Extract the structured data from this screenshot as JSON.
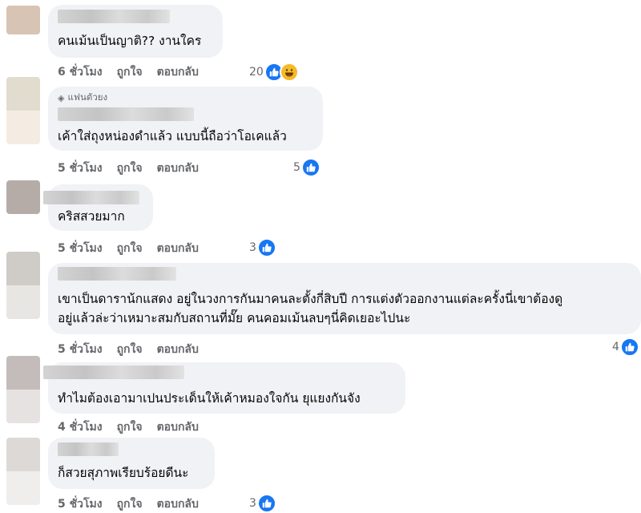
{
  "comments": [
    {
      "text": "คนเม้นเป็นญาติ?? งานใคร",
      "actions": {
        "time": "6 ชั่วโมง",
        "like": "ถูกใจ",
        "reply": "ตอบกลับ"
      },
      "reaction_count": "20",
      "reactions": [
        "like-icon",
        "haha-icon"
      ]
    },
    {
      "badge": "แฟนตัวยง",
      "text": "เค้าใส่ถุงหน่องดำแล้ว แบบนี้ถือว่าโอเคแล้ว",
      "actions": {
        "time": "5 ชั่วโมง",
        "like": "ถูกใจ",
        "reply": "ตอบกลับ"
      },
      "reaction_count": "5",
      "reactions": [
        "like-icon"
      ]
    },
    {
      "text": "คริสสวยมาก",
      "actions": {
        "time": "5 ชั่วโมง",
        "like": "ถูกใจ",
        "reply": "ตอบกลับ"
      },
      "reaction_count": "3",
      "reactions": [
        "like-icon"
      ]
    },
    {
      "text_lines": [
        "เขาเป็นดาราน้กแสดง อยู่ในวงการกันมาคนละตั้งกี่สิบปี การแต่งตัวออกงานแต่ละครั้งนี่เขาต้องดู",
        "อยู่แล้วล่ะว่าเหมาะสมกับสถานที่มั๊ย คนคอมเม้นลบๆนี่คิดเยอะไปนะ"
      ],
      "actions": {
        "time": "5 ชั่วโมง",
        "like": "ถูกใจ",
        "reply": "ตอบกลับ"
      },
      "reaction_count": "4",
      "reactions": [
        "like-icon"
      ]
    },
    {
      "text": "ทำไมต้องเอามาเปนประเด็นให้เค้าหมองใจกัน ยุแยงกันจัง",
      "actions": {
        "time": "4 ชั่วโมง",
        "like": "ถูกใจ",
        "reply": "ตอบกลับ"
      }
    },
    {
      "text": "ก็สวยสุภาพเรียบร้อยดีนะ",
      "actions": {
        "time": "5 ชั่วโมง",
        "like": "ถูกใจ",
        "reply": "ตอบกลับ"
      },
      "reaction_count": "3",
      "reactions": [
        "like-icon"
      ]
    }
  ],
  "colors": {
    "bubble": "#f0f2f5",
    "like": "#1877f2",
    "meta": "#65676b",
    "text": "#050505"
  }
}
